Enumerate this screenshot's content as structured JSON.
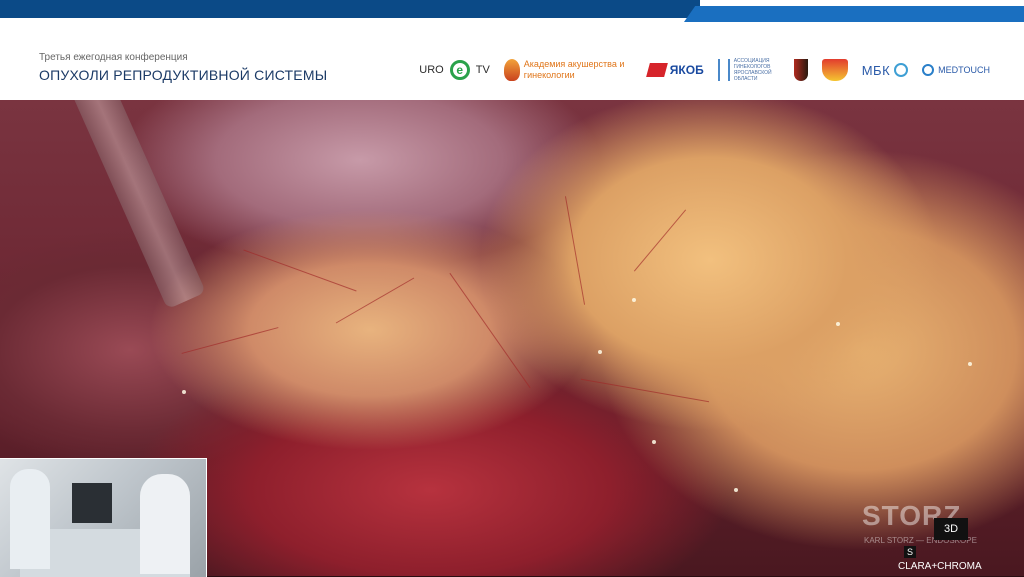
{
  "header": {
    "subtitle": "Третья ежегодная конференция",
    "title": "ОПУХОЛИ РЕПРОДУКТИВНОЙ СИСТЕМЫ"
  },
  "logos": {
    "urotv_left": "URO",
    "urotv_mid": "e",
    "urotv_right": "TV",
    "academy": "Академия акушерства и гинекологии",
    "yakob": "ЯКОБ",
    "association": "АССОЦИАЦИЯ ГИНЕКОЛОГОВ ЯРОСЛАВСКОЙ ОБЛАСТИ",
    "mbk": "МБК",
    "medtouch": "MEDTOUCH"
  },
  "video": {
    "watermark": "STORZ",
    "watermark_sub": "KARL STORZ — ENDOSKOPE",
    "badge_3d": "3D",
    "s_icon": "S",
    "mode": "CLARA+CHROMA"
  },
  "colors": {
    "brand_blue": "#0b4a87",
    "accent_blue": "#1a6fc0"
  }
}
